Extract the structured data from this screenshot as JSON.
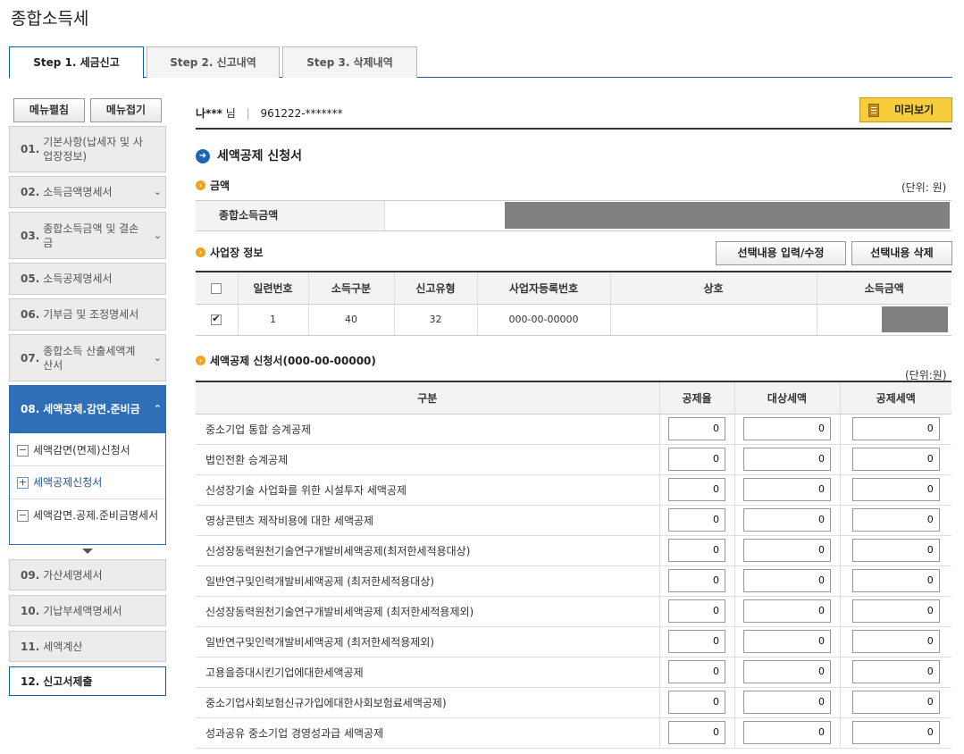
{
  "page_title": "종합소득세",
  "tabs": [
    {
      "label": "Step 1. 세금신고",
      "active": true
    },
    {
      "label": "Step 2. 신고내역",
      "active": false
    },
    {
      "label": "Step 3. 삭제내역",
      "active": false
    }
  ],
  "sidebar": {
    "expand_label": "메뉴펼침",
    "collapse_label": "메뉴접기",
    "items": [
      {
        "num": "01.",
        "label": "기본사항(납세자 및 사업장정보)"
      },
      {
        "num": "02.",
        "label": "소득금액명세서"
      },
      {
        "num": "03.",
        "label": "종합소득금액 및 결손금"
      },
      {
        "num": "05.",
        "label": "소득공제명세서"
      },
      {
        "num": "06.",
        "label": "기부금 및 조정명세서"
      },
      {
        "num": "07.",
        "label": "종합소득 산출세액계산서"
      },
      {
        "num": "08.",
        "label": "세액공제.감면.준비금"
      },
      {
        "num": "09.",
        "label": "가산세명세서"
      },
      {
        "num": "10.",
        "label": "기납부세액명세서"
      },
      {
        "num": "11.",
        "label": "세액계산"
      },
      {
        "num": "12.",
        "label": "신고서제출"
      }
    ],
    "sub_items": [
      {
        "label": "세액감면(면제)신청서",
        "icon": "−"
      },
      {
        "label": "세액공제신청서",
        "icon": "+"
      },
      {
        "label": "세액감면.공제.준비금명세서",
        "icon": "−"
      }
    ]
  },
  "user": {
    "name": "나***",
    "honorific": "님",
    "id_number": "961222-*******"
  },
  "preview_label": "미리보기",
  "section_title": "세액공제 신청서",
  "amount_section": {
    "title": "금액",
    "unit": "(단위: 원)",
    "label": "종합소득금액"
  },
  "business_section": {
    "title": "사업장 정보",
    "edit_button": "선택내용 입력/수정",
    "delete_button": "선택내용 삭제",
    "columns": [
      "일련번호",
      "소득구분",
      "신고유형",
      "사업자등록번호",
      "상호",
      "소득금액"
    ],
    "rows": [
      {
        "serial": "1",
        "income_type": "40",
        "report_type": "32",
        "biz_no": "000-00-00000",
        "name": ""
      }
    ]
  },
  "deduction_section": {
    "title": "세액공제 신청서(000-00-00000)",
    "unit": "(단위:원)",
    "columns": [
      "구분",
      "공제율",
      "대상세액",
      "공제세액"
    ],
    "rows": [
      {
        "name": "중소기업 통합 승계공제",
        "rate": "0",
        "target": "0",
        "deduct": "0"
      },
      {
        "name": "법인전환 승계공제",
        "rate": "0",
        "target": "0",
        "deduct": "0"
      },
      {
        "name": "신성장기술 사업화를 위한 시설투자 세액공제",
        "rate": "0",
        "target": "0",
        "deduct": "0"
      },
      {
        "name": "영상콘텐츠 제작비용에 대한 세액공제",
        "rate": "0",
        "target": "0",
        "deduct": "0"
      },
      {
        "name": "신성장동력원천기술연구개발비세액공제(최저한세적용대상)",
        "rate": "0",
        "target": "0",
        "deduct": "0"
      },
      {
        "name": "일반연구및인력개발비세액공제 (최저한세적용대상)",
        "rate": "0",
        "target": "0",
        "deduct": "0"
      },
      {
        "name": "신성장동력원천기술연구개발비세액공제 (최저한세적용제외)",
        "rate": "0",
        "target": "0",
        "deduct": "0"
      },
      {
        "name": "일반연구및인력개발비세액공제 (최저한세적용제외)",
        "rate": "0",
        "target": "0",
        "deduct": "0"
      },
      {
        "name": "고용을증대시킨기업에대한세액공제",
        "rate": "0",
        "target": "0",
        "deduct": "0"
      },
      {
        "name": "중소기업사회보험신규가입에대한사회보험료세액공제)",
        "rate": "0",
        "target": "0",
        "deduct": "0"
      },
      {
        "name": "성과공유 중소기업 경영성과급 세액공제",
        "rate": "0",
        "target": "0",
        "deduct": "0"
      }
    ]
  }
}
